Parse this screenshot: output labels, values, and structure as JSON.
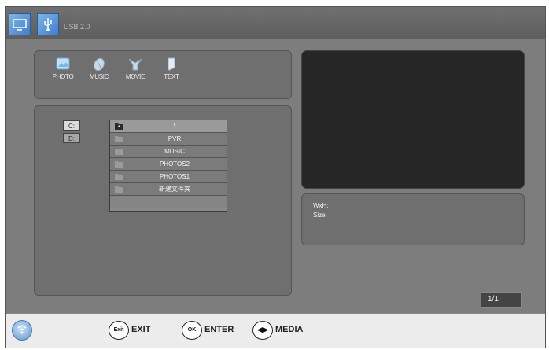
{
  "header": {
    "label": "USB 2.0",
    "icons": [
      "tv-icon",
      "usb-icon"
    ]
  },
  "media_tabs": [
    {
      "label": "PHOTO",
      "icon": "photo-icon"
    },
    {
      "label": "MUSIC",
      "icon": "music-icon"
    },
    {
      "label": "MOVIE",
      "icon": "movie-icon"
    },
    {
      "label": "TEXT",
      "icon": "text-icon"
    }
  ],
  "drives": [
    {
      "label": "C:",
      "selected": true
    },
    {
      "label": "D:",
      "selected": false
    }
  ],
  "files": [
    {
      "name": "\\",
      "icon": "up-folder-icon",
      "selected": true
    },
    {
      "name": "PVR",
      "icon": "folder-icon"
    },
    {
      "name": "MUSIC",
      "icon": "folder-icon"
    },
    {
      "name": "PHOTOS2",
      "icon": "folder-icon"
    },
    {
      "name": "PHOTOS1",
      "icon": "folder-icon"
    },
    {
      "name": "新建文件夹",
      "icon": "folder-icon"
    },
    {
      "name": "",
      "icon": ""
    }
  ],
  "info": {
    "wxh_label": "WxH:",
    "size_label": "Size:"
  },
  "page_indicator": "1/1",
  "footer": {
    "logo_icon": "brand-logo-icon",
    "hints": [
      {
        "key": "Exit",
        "label": "EXIT"
      },
      {
        "key": "OK",
        "label": "ENTER"
      },
      {
        "key": "◀▶",
        "label": "MEDIA"
      }
    ]
  },
  "colors": {
    "main_bg": "#7d7d7d",
    "panel_bg": "#6f6f6f",
    "preview_bg": "#262626",
    "accent_blue": "#3d7fd0"
  }
}
